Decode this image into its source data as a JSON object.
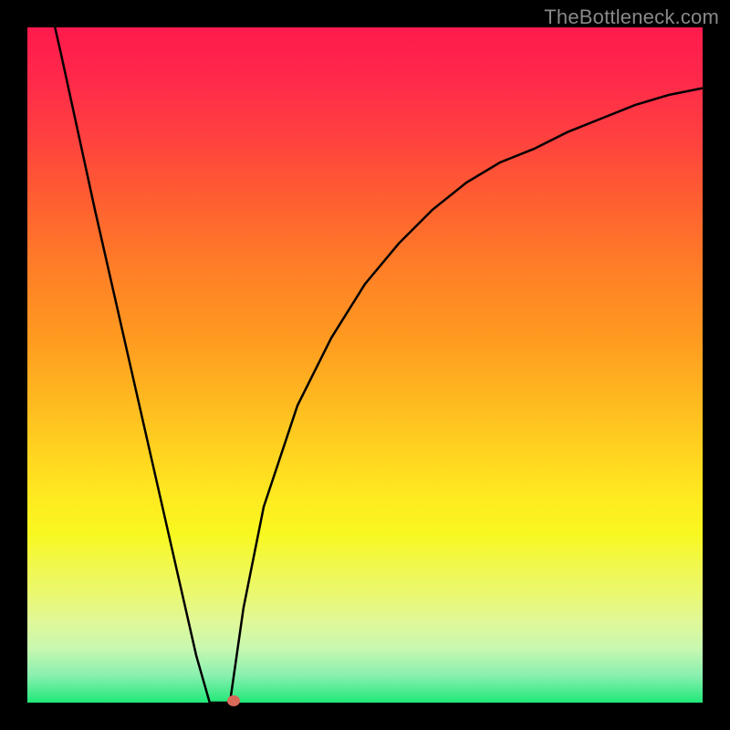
{
  "watermark": {
    "text": "TheBottleneck.com"
  },
  "colors": {
    "top": "#ff1a4d",
    "bottom": "#20e878",
    "curve": "#000000",
    "marker": "#d86a5a",
    "background": "#000000"
  },
  "chart_data": {
    "type": "line",
    "x": [
      0,
      5,
      10,
      15,
      20,
      25,
      27,
      29,
      30,
      31,
      32,
      35,
      40,
      45,
      50,
      55,
      60,
      65,
      70,
      75,
      80,
      85,
      90,
      95,
      100
    ],
    "values": [
      118,
      96,
      73,
      51,
      29,
      7,
      0,
      0,
      0,
      7,
      14,
      29,
      44,
      54,
      62,
      68,
      73,
      77,
      80,
      82,
      84.5,
      86.5,
      88.5,
      90,
      91
    ],
    "xlabel": "",
    "ylabel": "",
    "xlim": [
      0,
      100
    ],
    "ylim": [
      0,
      100
    ],
    "title": "",
    "grid": false,
    "marker": {
      "x": 30.5,
      "y": 0
    }
  }
}
